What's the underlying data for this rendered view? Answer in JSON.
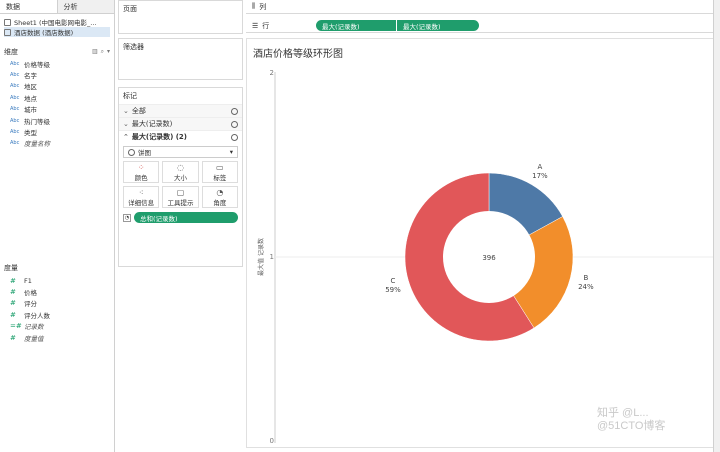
{
  "left_pane": {
    "tabs": [
      "数据",
      "分析"
    ],
    "sources": [
      "Sheet1 (中国电影网电影_...",
      "酒店数据 (酒店数据)"
    ],
    "dimensions_header": "维度",
    "dimensions": [
      {
        "type": "Abc",
        "label": "价格等级",
        "italic": false
      },
      {
        "type": "Abc",
        "label": "名字",
        "italic": false
      },
      {
        "type": "Abc",
        "label": "地区",
        "italic": false
      },
      {
        "type": "Abc",
        "label": "地点",
        "italic": false
      },
      {
        "type": "Abc",
        "label": "城市",
        "italic": false
      },
      {
        "type": "Abc",
        "label": "热门等级",
        "italic": false
      },
      {
        "type": "Abc",
        "label": "类型",
        "italic": false
      },
      {
        "type": "Abc",
        "label": "度量名称",
        "italic": true
      }
    ],
    "measures_header": "度量",
    "measures": [
      {
        "type": "#",
        "label": "F1",
        "italic": false
      },
      {
        "type": "#",
        "label": "价格",
        "italic": false
      },
      {
        "type": "#",
        "label": "评分",
        "italic": false
      },
      {
        "type": "#",
        "label": "评分人数",
        "italic": false
      },
      {
        "type": "=#",
        "label": "记录数",
        "italic": true
      },
      {
        "type": "#",
        "label": "度量值",
        "italic": true
      }
    ]
  },
  "pages_title": "页面",
  "filters_title": "筛选器",
  "marks": {
    "title": "标记",
    "rows": [
      "全部",
      "最大(记录数)",
      "最大(记录数) (2)"
    ],
    "mark_type": "饼图",
    "buttons": [
      "颜色",
      "大小",
      "标签",
      "详细信息",
      "工具提示",
      "角度"
    ],
    "pill": "总和(记录数)"
  },
  "shelves": {
    "columns_label": "列",
    "rows_label": "行",
    "row_pills": [
      "最大(记录数)",
      "最大(记录数)"
    ]
  },
  "chart_data": {
    "type": "pie",
    "title": "酒店价格等级环形图",
    "ylabel": "最大值 记录数",
    "ylim": [
      0,
      2
    ],
    "yticks": [
      "2",
      "1",
      "0"
    ],
    "center_label": "396",
    "categories": [
      "A",
      "B",
      "C"
    ],
    "values": [
      17,
      24,
      59
    ],
    "value_labels": [
      "17%",
      "24%",
      "59%"
    ],
    "colors": [
      "#4e79a7",
      "#f28e2b",
      "#e15759"
    ]
  },
  "watermark": "知乎 @L...\n@51CTO博客"
}
